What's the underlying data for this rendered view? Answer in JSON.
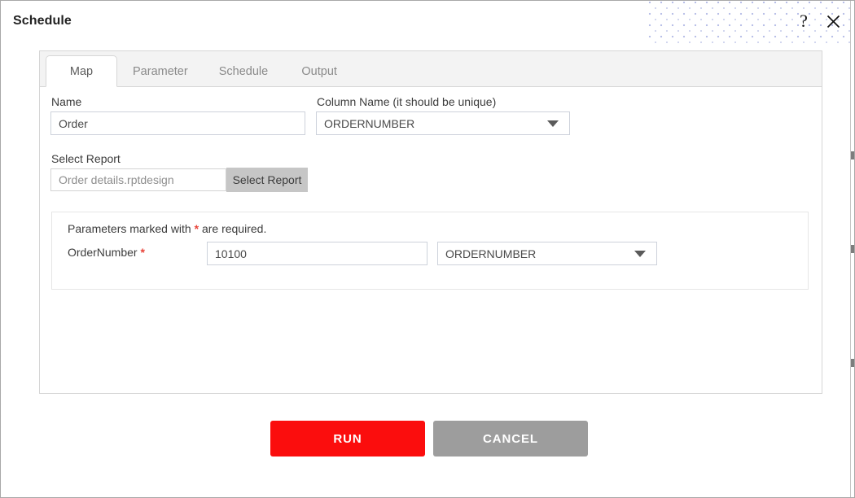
{
  "window": {
    "title": "Schedule",
    "help_icon": "question-mark-icon",
    "close_icon": "close-x-icon"
  },
  "tabs": [
    {
      "label": "Map",
      "active": true
    },
    {
      "label": "Parameter",
      "active": false
    },
    {
      "label": "Schedule",
      "active": false
    },
    {
      "label": "Output",
      "active": false
    }
  ],
  "form": {
    "name_label": "Name",
    "name_value": "Order",
    "column_label": "Column Name (it should be unique)",
    "column_value": "ORDERNUMBER",
    "select_report_label": "Select Report",
    "report_value": "Order details.rptdesign",
    "select_report_button": "Select Report"
  },
  "parameters": {
    "note_prefix": "Parameters marked with",
    "note_star": "*",
    "note_suffix": "are required.",
    "rows": [
      {
        "label": "OrderNumber",
        "required_star": "*",
        "value": "10100",
        "column": "ORDERNUMBER"
      }
    ]
  },
  "footer": {
    "run_label": "RUN",
    "cancel_label": "CANCEL"
  },
  "colors": {
    "run_background": "#fb0d0d",
    "cancel_background": "#9d9d9d",
    "required_star": "#e8443a",
    "dot_pattern": "#b9c0e8"
  }
}
